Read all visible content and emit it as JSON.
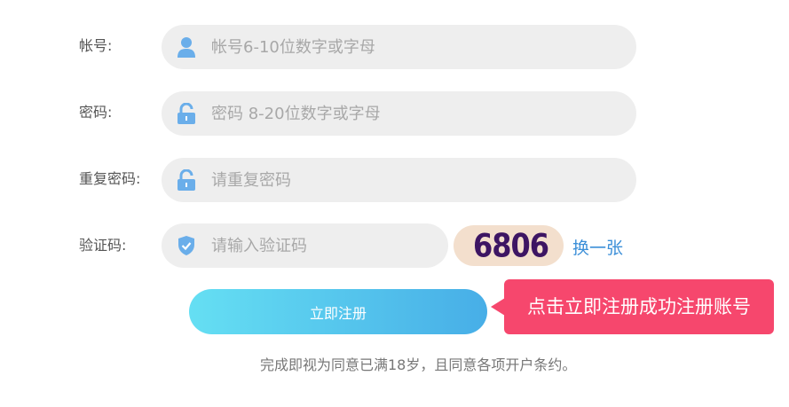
{
  "form": {
    "account": {
      "label": "帐号:",
      "placeholder": "帐号6-10位数字或字母",
      "icon": "user-icon"
    },
    "password": {
      "label": "密码:",
      "placeholder": "密码 8-20位数字或字母",
      "icon": "lock-icon"
    },
    "confirm_password": {
      "label": "重复密码:",
      "placeholder": "请重复密码",
      "icon": "lock-icon"
    },
    "captcha": {
      "label": "验证码:",
      "placeholder": "请输入验证码",
      "icon": "shield-check-icon",
      "code": "6806",
      "refresh_label": "换一张"
    },
    "register_button": "立即注册",
    "tooltip": "点击立即注册成功注册账号",
    "agreement": "完成即视为同意已满18岁，且同意各项开户条约。"
  },
  "colors": {
    "icon": "#6aaeea",
    "field_bg": "#eeeeee",
    "button_start": "#65dff3",
    "button_end": "#47aee7",
    "tooltip_bg": "#f6476d",
    "link": "#3c8fd8",
    "captcha_bg": "#f3dfcd"
  }
}
